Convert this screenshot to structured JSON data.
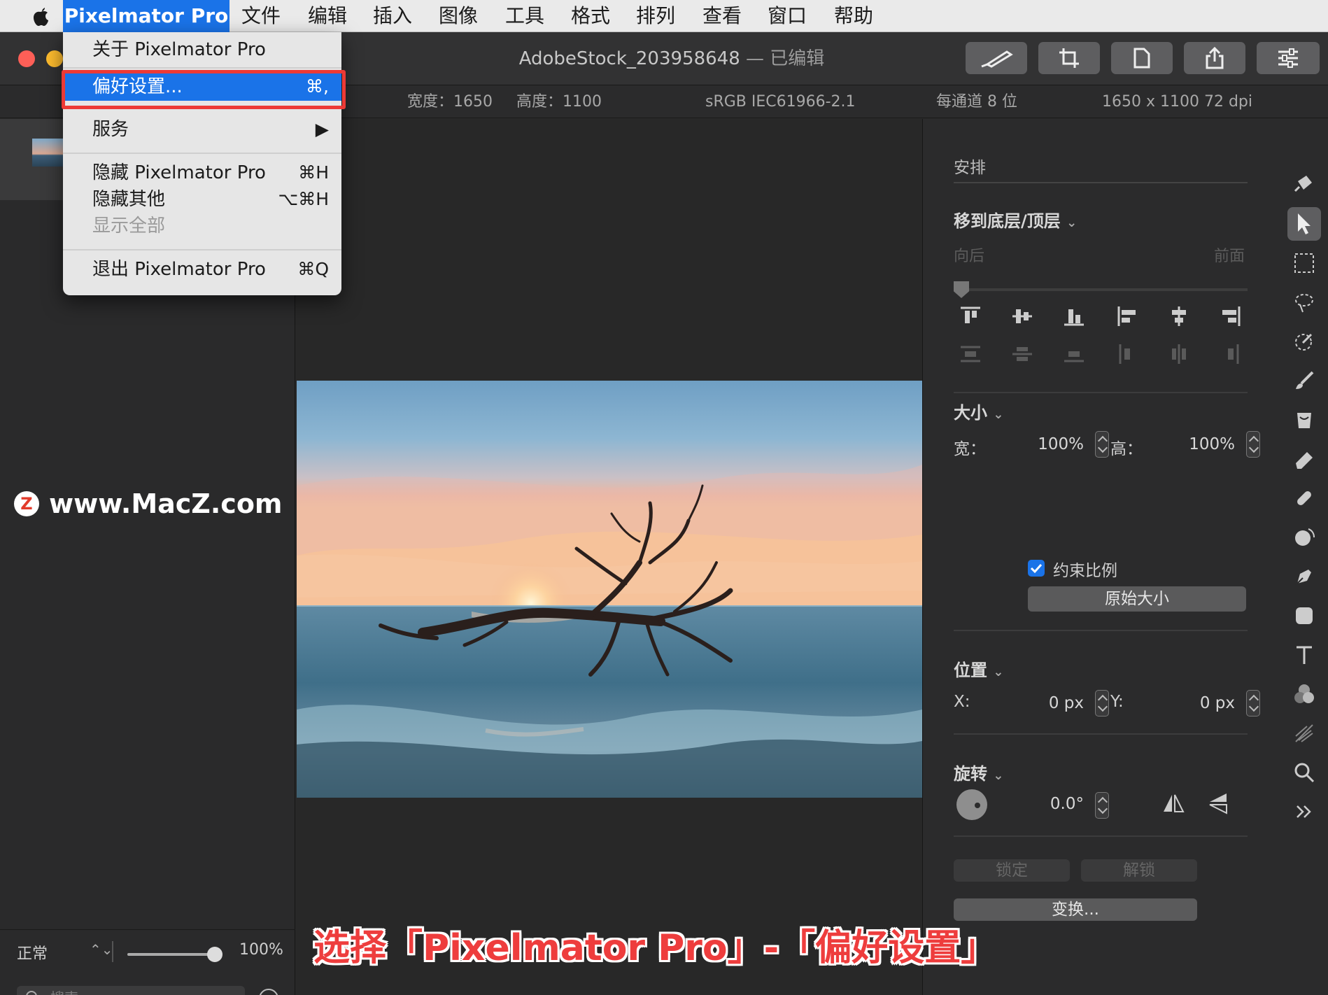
{
  "menubar": {
    "app_name": "Pixelmator Pro",
    "items": [
      "文件",
      "编辑",
      "插入",
      "图像",
      "工具",
      "格式",
      "排列",
      "查看",
      "窗口",
      "帮助"
    ]
  },
  "app_menu": {
    "about": "关于 Pixelmator Pro",
    "preferences": "偏好设置...",
    "preferences_shortcut": "⌘,",
    "services": "服务",
    "services_arrow": "▶",
    "hide_app": "隐藏 Pixelmator Pro",
    "hide_app_shortcut": "⌘H",
    "hide_others": "隐藏其他",
    "hide_others_shortcut": "⌥⌘H",
    "show_all": "显示全部",
    "quit": "退出 Pixelmator Pro",
    "quit_shortcut": "⌘Q"
  },
  "window": {
    "document_name": "AdobeStock_203958648",
    "edited_suffix": " — 已编辑"
  },
  "info_bar": {
    "width": "宽度：1650",
    "height": "高度：1100",
    "color_profile": "sRGB IEC61966-2.1",
    "bit_depth": "每通道 8 位",
    "dimensions": "1650 x 1100 72 dpi"
  },
  "sidebar": {
    "watermark": "www.MacZ.com",
    "watermark_logo": "Z",
    "blend_mode": "正常",
    "opacity": "100%",
    "opacity_level": 1.0,
    "search_placeholder": "搜索"
  },
  "inspector": {
    "header": "安排",
    "arrange": {
      "title": "移到底层/顶层",
      "back_label": "向后",
      "front_label": "前面"
    },
    "size": {
      "title": "大小",
      "width_label": "宽：",
      "width_value": "100%",
      "height_label": "高：",
      "height_value": "100%",
      "constrain_label": "约束比例",
      "constrain_checked": true,
      "original_size_button": "原始大小"
    },
    "position": {
      "title": "位置",
      "x_label": "X:",
      "x_value": "0 px",
      "y_label": "Y:",
      "y_value": "0 px"
    },
    "rotate": {
      "title": "旋转",
      "value": "0.0°"
    },
    "lock_button": "锁定",
    "unlock_button": "解锁",
    "transform_button": "变换..."
  },
  "caption": "选择「Pixelmator Pro」-「偏好设置」",
  "colors": {
    "accent": "#1a73e8",
    "highlight": "#ec3a36",
    "close": "#fe5f57",
    "minimize": "#febc2e"
  }
}
